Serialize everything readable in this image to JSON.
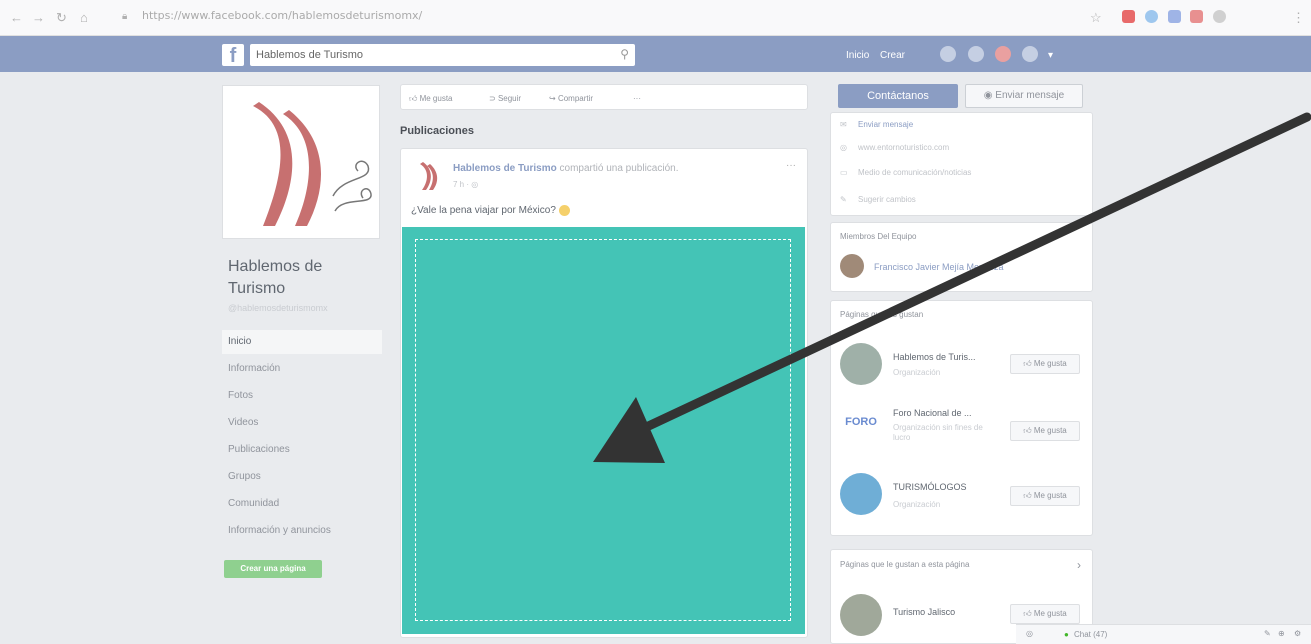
{
  "browser": {
    "url": "https://www.facebook.com/hablemosdeturismomx/"
  },
  "fb_header": {
    "logo": "f",
    "search_value": "Hablemos de Turismo",
    "nav_home": "Inicio",
    "nav_create": "Crear"
  },
  "page": {
    "name": "Hablemos de Turismo",
    "handle": "@hablemosdeturismomx"
  },
  "left_nav": [
    "Inicio",
    "Información",
    "Fotos",
    "Videos",
    "Publicaciones",
    "Grupos",
    "Comunidad",
    "Información y anuncios"
  ],
  "create_page_label": "Crear una página",
  "action_bar": {
    "like": "Me gusta",
    "follow": "Seguir",
    "share": "Compartir",
    "more": "···"
  },
  "publications": {
    "title": "Publicaciones",
    "post_author": "Hablemos de Turismo",
    "post_action": " compartió una publicación.",
    "post_time": "7 h",
    "post_text": "¿Vale la pena viajar por México?",
    "post_more": "···"
  },
  "right": {
    "contact_label": "Contáctanos",
    "message_label": "Enviar mensaje",
    "info_send_message": "Enviar mensaje",
    "info_website": "www.entornoturistico.com",
    "info_category": "Medio de comunicación/noticias",
    "info_suggest": "Sugerir cambios",
    "team_title": "Miembros Del Equipo",
    "team_member": "Francisco Javier Mejía Mendoza",
    "liked_title": "Páginas que les gustan",
    "liked_pages": [
      {
        "name": "Hablemos de Turis...",
        "category": "Organización",
        "like": "Me gusta"
      },
      {
        "name": "Foro Nacional de ...",
        "category": "Organización sin fines de lucro",
        "like": "Me gusta"
      },
      {
        "name": "TURISMÓLOGOS",
        "category": "Organización",
        "like": "Me gusta"
      }
    ],
    "pages_liked_by_page_title": "Páginas que le gustan a esta página",
    "pages_liked_by_page": [
      {
        "name": "Turismo Jalisco",
        "like": "Me gusta"
      }
    ]
  },
  "chat": {
    "label": "Chat (47)"
  },
  "colors": {
    "fb_bar": "#8b9dc3",
    "post_image": "#44c4b6",
    "arrow": "#333333"
  }
}
